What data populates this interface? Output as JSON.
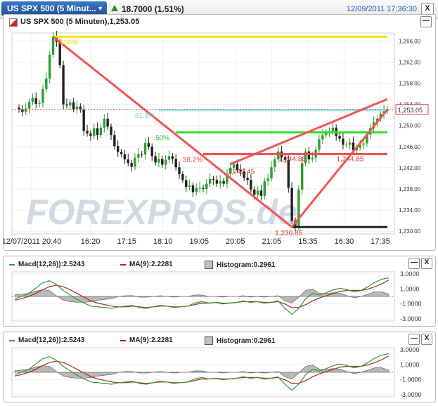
{
  "header": {
    "symbol": "US SPX 500 (5 Minut...",
    "price": "18.7000 (1.51%)",
    "timestamp": "12/09/2011 17:36:30",
    "close_label": "X"
  },
  "main_panel": {
    "title": "US SPX 500 (5 Minuten),1,253.05",
    "minimize_label": "—"
  },
  "macd_panel_1": {
    "macd_label": "Macd(12,26)):2.5243",
    "ma_label": "MA(9):2.2281",
    "hist_label": "Histogram:0.2961",
    "minimize_label": "—",
    "close_label": "X"
  },
  "macd_panel_2": {
    "macd_label": "Macd(12,26)):2.5243",
    "ma_label": "MA(9):2.2281",
    "hist_label": "Histogram:0.2961",
    "minimize_label": "—",
    "close_label": "X"
  },
  "colors": {
    "up": "#2e9e2e",
    "down": "#222222",
    "fib100": "#ffe000",
    "fib618": "#8ff0f0",
    "fib50": "#33dd33",
    "fib382": "#e84b4b",
    "trend": "#f05555",
    "macd": "#2e9e2e",
    "ma": "#b52222",
    "hist": "#b8b8b8"
  },
  "chart_data": [
    {
      "type": "candlestick",
      "title": "US SPX 500 (5 Minuten),1,253.05",
      "x_ticks": [
        "12/07/2011 20:40",
        "16:20",
        "17:15",
        "18:10",
        "19:05",
        "20:05",
        "21:05",
        "15:35",
        "16:30",
        "17:35"
      ],
      "y_ticks": [
        "1,266.00",
        "1,262.00",
        "1,258.00",
        "1,254.00",
        "1,250.00",
        "1,246.00",
        "1,242.00",
        "1,238.00",
        "1,234.00",
        "1,230.00"
      ],
      "ylim": [
        1229.5,
        1267.5
      ],
      "last_price": 1253.05,
      "last_price_label": "1,253.05",
      "closes": [
        1253.0,
        1252.6,
        1253.2,
        1254.5,
        1255.2,
        1254.1,
        1254.3,
        1256.9,
        1258.9,
        1263.4,
        1266.8,
        1265.8,
        1261.4,
        1254.0,
        1253.8,
        1254.4,
        1253.1,
        1253.6,
        1253.0,
        1249.0,
        1248.5,
        1248.0,
        1249.5,
        1248.2,
        1249.6,
        1251.3,
        1249.8,
        1248.2,
        1246.1,
        1245.0,
        1244.6,
        1243.6,
        1242.9,
        1242.2,
        1243.9,
        1244.6,
        1244.5,
        1246.7,
        1246.0,
        1244.2,
        1243.0,
        1243.7,
        1242.6,
        1243.5,
        1244.2,
        1243.7,
        1242.1,
        1240.8,
        1239.7,
        1238.4,
        1238.7,
        1237.4,
        1238.2,
        1238.2,
        1238.0,
        1239.0,
        1239.9,
        1239.7,
        1239.0,
        1239.5,
        1239.0,
        1240.9,
        1242.0,
        1242.7,
        1241.6,
        1241.3,
        1240.1,
        1239.7,
        1237.9,
        1236.9,
        1237.7,
        1236.7,
        1239.5,
        1240.0,
        1242.1,
        1243.6,
        1245.1,
        1244.0,
        1243.5,
        1238.2,
        1232.0,
        1230.8,
        1237.9,
        1242.9,
        1245.1,
        1243.6,
        1243.9,
        1245.4,
        1247.4,
        1248.2,
        1248.7,
        1248.8,
        1249.6,
        1248.0,
        1247.5,
        1246.4,
        1246.4,
        1246.8,
        1245.3,
        1245.8,
        1246.4,
        1246.6,
        1248.3,
        1249.5,
        1250.6,
        1251.3,
        1252.2,
        1252.8,
        1253.1
      ],
      "fib_levels": [
        {
          "label": "100%",
          "value": 1266.8
        },
        {
          "label": "61.8%",
          "value": 1252.9
        },
        {
          "label": "50%",
          "value": 1248.7
        },
        {
          "label": "38.2%",
          "value": 1244.6
        }
      ],
      "annotations": [
        {
          "label": "1,242.45",
          "x_index": 66,
          "value": 1242.45
        },
        {
          "label": "1,244.85",
          "x_index": 98,
          "value": 1244.85
        },
        {
          "label": "1,244.85",
          "x_index": 81,
          "value": 1244.85
        },
        {
          "label": "1,230.85",
          "x_index": 80,
          "value": 1230.85
        }
      ],
      "lines": [
        {
          "kind": "horizontal",
          "value": 1266.8,
          "from": 10,
          "to": 108,
          "color": "fib100"
        },
        {
          "kind": "horizontal",
          "value": 1252.9,
          "from": 41,
          "to": 108,
          "color": "fib618"
        },
        {
          "kind": "horizontal",
          "value": 1248.7,
          "from": 46,
          "to": 108,
          "color": "fib50"
        },
        {
          "kind": "horizontal",
          "value": 1244.6,
          "from": 54,
          "to": 108,
          "color": "fib382"
        },
        {
          "kind": "horizontal",
          "value": 1230.8,
          "from": 80,
          "to": 108,
          "color": "down"
        },
        {
          "kind": "trend",
          "from": [
            10,
            1266.8
          ],
          "to": [
            80,
            1230.8
          ]
        },
        {
          "kind": "trend",
          "from": [
            80,
            1230.8
          ],
          "to": [
            108,
            1253.0
          ]
        },
        {
          "kind": "trend",
          "from": [
            62,
            1242.7
          ],
          "to": [
            108,
            1255.0
          ]
        }
      ],
      "watermark": "FOREXPROS.de"
    },
    {
      "type": "macd",
      "series": [
        {
          "name": "Macd(12,26))",
          "values": [
            -0.3,
            0.0,
            0.4,
            1.1,
            1.8,
            2.1,
            1.6,
            0.8,
            0.2,
            -0.4,
            -0.9,
            -1.3,
            -1.4,
            -1.5,
            -1.6,
            -1.4,
            -1.3,
            -1.2,
            -1.5,
            -1.6,
            -1.4,
            -1.2,
            -1.3,
            -1.5,
            -1.4,
            -1.3,
            -0.9,
            -0.7,
            -0.9,
            -0.8,
            -1.0,
            -0.9,
            -0.8,
            -0.6,
            -0.8,
            -0.7,
            -0.9,
            -0.8,
            -0.6,
            -1.6,
            -2.4,
            -1.6,
            -0.3,
            0.4,
            0.2,
            0.5,
            0.9,
            1.1,
            0.9,
            0.6,
            0.8,
            1.3,
            1.9,
            2.3,
            2.5
          ]
        },
        {
          "name": "MA(9)",
          "values": [
            -0.5,
            -0.3,
            0.0,
            0.4,
            0.9,
            1.3,
            1.5,
            1.3,
            0.9,
            0.4,
            -0.1,
            -0.6,
            -0.9,
            -1.1,
            -1.3,
            -1.4,
            -1.4,
            -1.3,
            -1.4,
            -1.5,
            -1.4,
            -1.3,
            -1.3,
            -1.4,
            -1.4,
            -1.3,
            -1.1,
            -0.9,
            -0.9,
            -0.8,
            -0.9,
            -0.9,
            -0.8,
            -0.7,
            -0.7,
            -0.7,
            -0.8,
            -0.8,
            -0.7,
            -1.0,
            -1.5,
            -1.5,
            -1.1,
            -0.6,
            -0.2,
            0.1,
            0.4,
            0.7,
            0.8,
            0.8,
            0.8,
            1.0,
            1.3,
            1.7,
            2.2
          ]
        },
        {
          "name": "Histogram",
          "values": [
            0.2,
            0.3,
            0.4,
            0.7,
            0.9,
            0.8,
            0.1,
            -0.5,
            -0.7,
            -0.8,
            -0.8,
            -0.7,
            -0.5,
            -0.4,
            -0.3,
            0.0,
            0.1,
            0.1,
            -0.1,
            -0.1,
            0.0,
            0.1,
            0.0,
            -0.1,
            0.0,
            0.0,
            0.2,
            0.2,
            0.0,
            0.0,
            -0.1,
            0.0,
            0.0,
            0.1,
            -0.1,
            0.0,
            -0.1,
            0.0,
            0.1,
            -0.6,
            -0.9,
            -0.1,
            0.8,
            1.0,
            0.4,
            0.4,
            0.5,
            0.4,
            0.1,
            -0.2,
            0.0,
            0.3,
            0.6,
            0.6,
            0.3
          ]
        }
      ],
      "y_ticks": [
        "3.0000",
        "1.0000",
        "-1.0000",
        "-3.0000"
      ],
      "ylim": [
        -3.3,
        3.3
      ]
    }
  ]
}
